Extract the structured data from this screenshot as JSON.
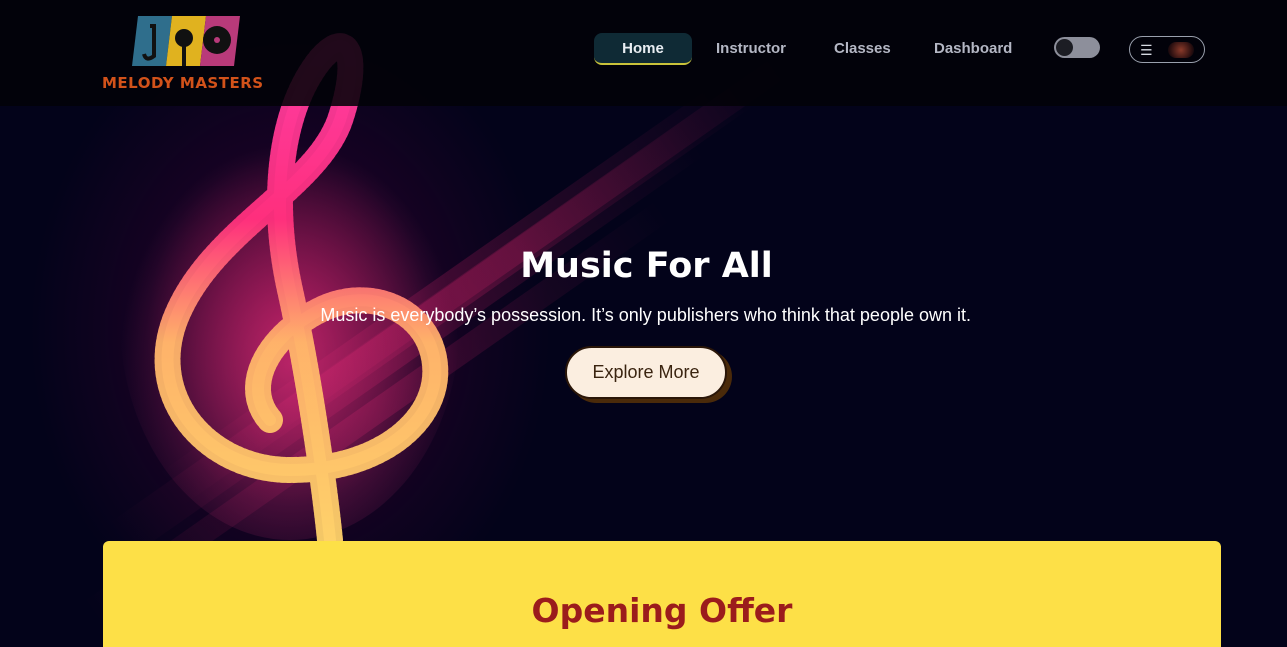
{
  "brand": {
    "name": "MELODY MASTERS",
    "logo_icon": "music-logo-icon"
  },
  "nav": {
    "items": [
      {
        "label": "Home",
        "active": true
      },
      {
        "label": "Instructor",
        "active": false
      },
      {
        "label": "Classes",
        "active": false
      },
      {
        "label": "Dashboard",
        "active": false
      }
    ],
    "theme_toggle": {
      "on": false
    },
    "menu_icon": "hamburger-icon",
    "avatar_icon": "user-avatar"
  },
  "hero": {
    "title": "Music For All",
    "subtitle": "Music is everybody’s possession. It’s only publishers who think that people own it.",
    "cta_label": "Explore More",
    "background_icon": "treble-clef-icon"
  },
  "offer": {
    "title": "Opening Offer"
  },
  "colors": {
    "page_bg": "#03031a",
    "brand_text": "#d2521a",
    "active_nav_bg": "#0f2a35",
    "active_nav_underline": "#c9c23a",
    "offer_bg": "#fde047",
    "offer_title": "#9b1c1c",
    "cta_bg": "#fbeee0"
  }
}
